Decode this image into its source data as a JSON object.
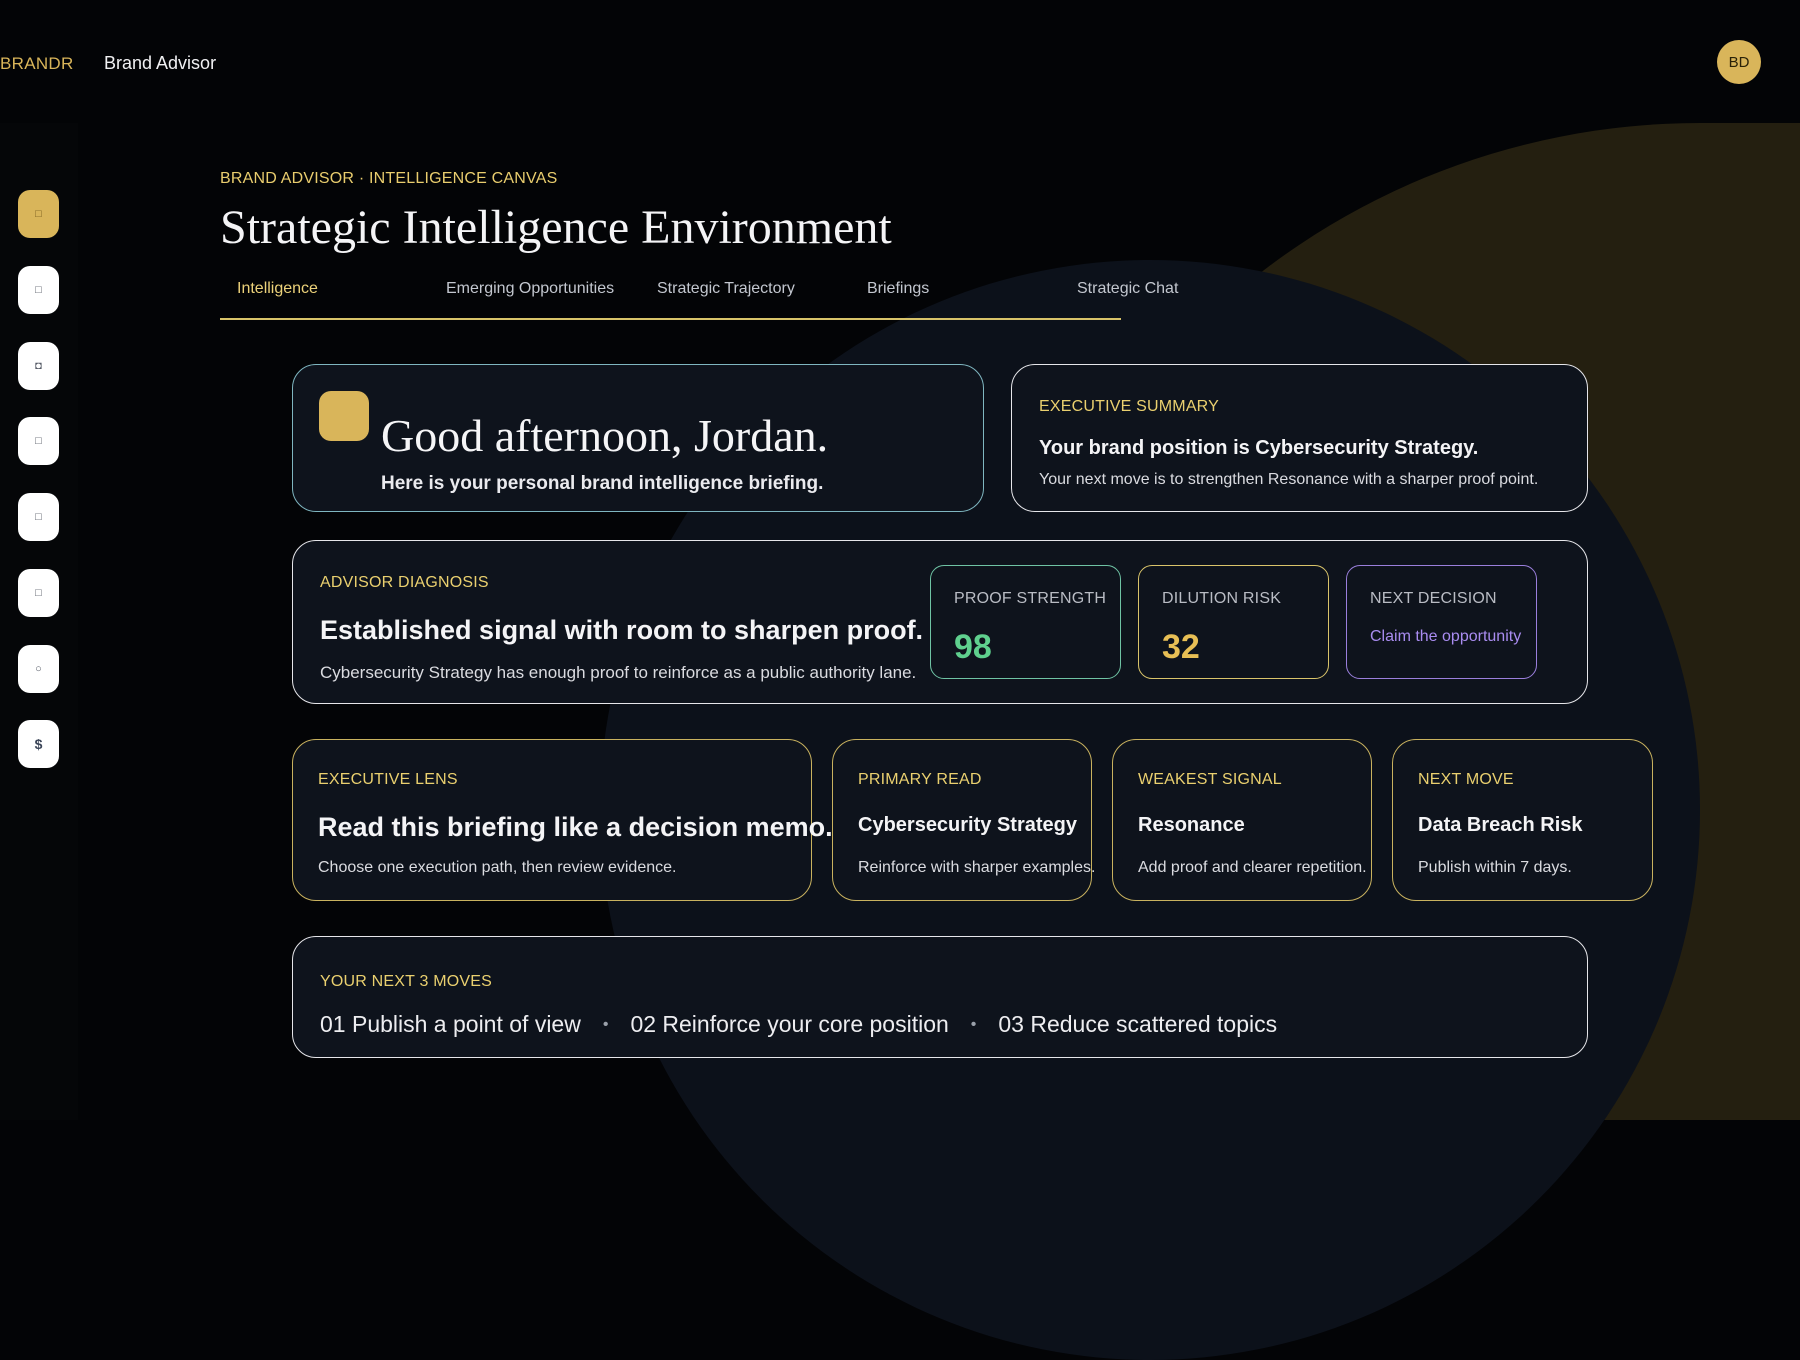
{
  "app": {
    "brand": "BRANDR",
    "product": "Brand Advisor",
    "avatar_initials": "BD"
  },
  "sidebar": {
    "items": [
      {
        "icon": "home-icon",
        "glyph": "□",
        "active": true
      },
      {
        "icon": "pulse-icon",
        "glyph": "□",
        "active": false
      },
      {
        "icon": "grid-icon",
        "glyph": "◘",
        "active": false
      },
      {
        "icon": "document-icon",
        "glyph": "□",
        "active": false
      },
      {
        "icon": "chart-icon",
        "glyph": "□",
        "active": false
      },
      {
        "icon": "target-icon",
        "glyph": "□",
        "active": false
      },
      {
        "icon": "settings-icon",
        "glyph": "○",
        "active": false
      },
      {
        "icon": "dollar-icon",
        "glyph": "$",
        "active": false
      }
    ]
  },
  "header": {
    "eyebrow": "BRAND ADVISOR · INTELLIGENCE CANVAS",
    "title": "Strategic Intelligence Environment"
  },
  "tabs": [
    {
      "label": "Intelligence",
      "active": true
    },
    {
      "label": "Emerging Opportunities",
      "active": false
    },
    {
      "label": "Strategic Trajectory",
      "active": false
    },
    {
      "label": "Briefings",
      "active": false
    },
    {
      "label": "Strategic Chat",
      "active": false
    }
  ],
  "hero": {
    "greeting": "Good afternoon, Jordan.",
    "subtitle": "Here is your personal brand intelligence briefing."
  },
  "executive_summary": {
    "eyebrow": "EXECUTIVE SUMMARY",
    "headline": "Your brand position is Cybersecurity Strategy.",
    "body": "Your next move is to strengthen Resonance with a sharper proof point."
  },
  "diagnosis": {
    "eyebrow": "ADVISOR DIAGNOSIS",
    "headline": "Established signal with room to sharpen proof.",
    "body": "Cybersecurity Strategy has enough proof to reinforce as a public authority lane.",
    "metrics": [
      {
        "label": "PROOF STRENGTH",
        "value": "98",
        "color": "#5fd08e",
        "border": "#6fc3a4"
      },
      {
        "label": "DILUTION RISK",
        "value": "32",
        "color": "#e8bf55",
        "border": "#d9c46a"
      },
      {
        "label": "NEXT DECISION",
        "value": "Claim the opportunity",
        "color": "#a98cf0",
        "border": "#9a7fdc"
      }
    ]
  },
  "lens": {
    "eyebrow": "EXECUTIVE LENS",
    "headline": "Read this briefing like a decision memo.",
    "body": "Choose one execution path, then review evidence."
  },
  "signals": [
    {
      "eyebrow": "PRIMARY READ",
      "headline": "Cybersecurity Strategy",
      "body": "Reinforce with sharper examples."
    },
    {
      "eyebrow": "WEAKEST SIGNAL",
      "headline": "Resonance",
      "body": "Add proof and clearer repetition."
    },
    {
      "eyebrow": "NEXT MOVE",
      "headline": "Data Breach Risk",
      "body": "Publish within 7 days."
    }
  ],
  "next_moves": {
    "eyebrow": "YOUR NEXT 3 MOVES",
    "items": [
      "01 Publish a point of view",
      "02 Reinforce your core position",
      "03 Reduce scattered topics"
    ]
  }
}
